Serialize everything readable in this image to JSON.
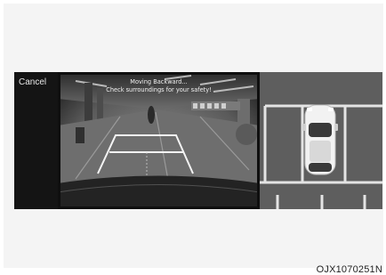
{
  "screen": {
    "cancel_label": "Cancel",
    "warning_line1": "Moving Backward...",
    "warning_line2": "Check surroundings for your safety!"
  },
  "figure_code": "OJX1070251N"
}
